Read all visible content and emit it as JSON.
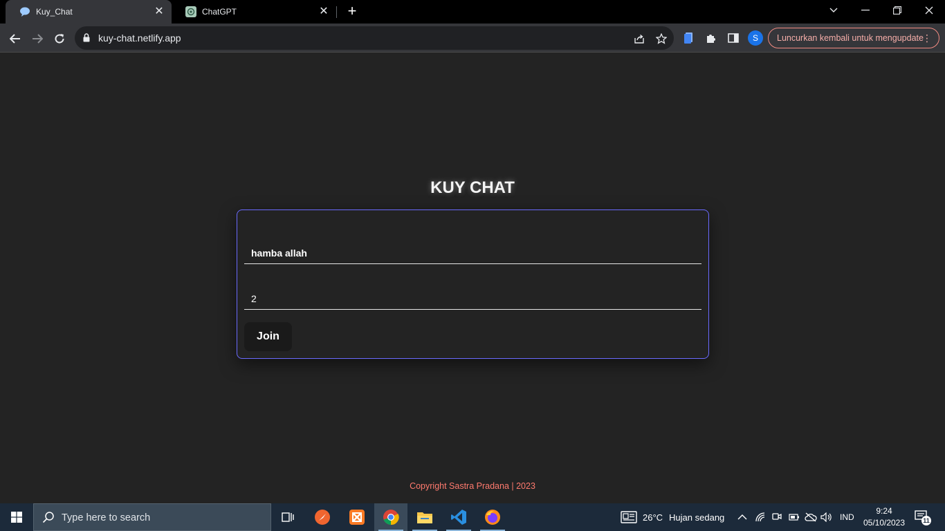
{
  "browser": {
    "tabs": [
      {
        "title": "Kuy_Chat",
        "active": true
      },
      {
        "title": "ChatGPT",
        "active": false
      }
    ],
    "url": "kuy-chat.netlify.app",
    "profile_initial": "S",
    "update_chip": "Luncurkan kembali untuk mengupdate"
  },
  "page": {
    "title": "KUY CHAT",
    "name_field": "hamba allah",
    "room_field": "2",
    "join_button": "Join",
    "copyright": "Copyright Sastra Pradana | 2023"
  },
  "taskbar": {
    "search_placeholder": "Type here to search",
    "weather_temp": "26°C",
    "weather_text": "Hujan sedang",
    "language": "IND",
    "time": "9:24",
    "date": "05/10/2023",
    "notification_count": "11"
  },
  "colors": {
    "background": "#232323",
    "card_border": "#6b6bff",
    "copyright": "#ff7a6e",
    "update_chip": "#f28b82"
  }
}
